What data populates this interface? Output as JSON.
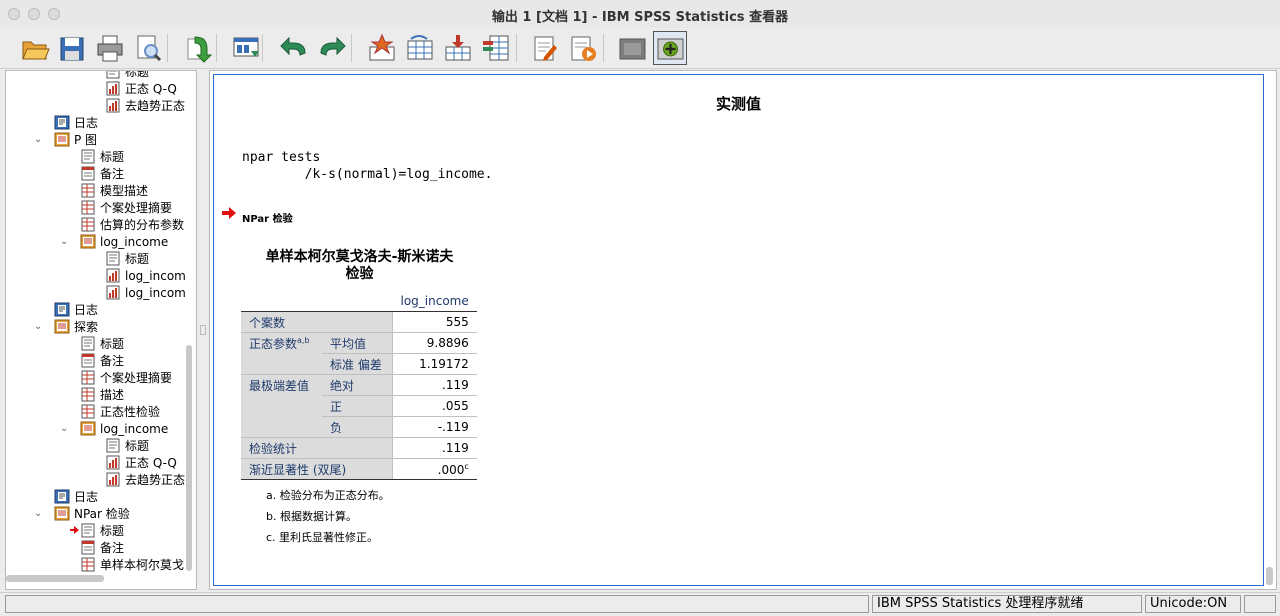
{
  "window": {
    "title": "输出 1 [文档 1] - IBM SPSS Statistics 查看器"
  },
  "toolbar": {
    "buttons": [
      {
        "name": "open-icon",
        "color": "#e8a23a"
      },
      {
        "name": "save-icon",
        "color": "#3a6fb6"
      },
      {
        "name": "print-icon",
        "color": "#666666"
      },
      {
        "name": "print-preview-icon",
        "color": "#6b8fc8"
      },
      {
        "name": "export-icon",
        "color": "#3f9e3f"
      },
      {
        "name": "recall-dialog-icon",
        "color": "#3a6fb6"
      },
      {
        "name": "undo-icon",
        "color": "#2e8b57"
      },
      {
        "name": "redo-icon",
        "color": "#2e8b57"
      },
      {
        "name": "goto-data-icon",
        "color": "#e06a1f"
      },
      {
        "name": "goto-case-icon",
        "color": "#3a6fb6"
      },
      {
        "name": "insert-cases-icon",
        "color": "#c0392b"
      },
      {
        "name": "variables-icon",
        "color": "#3a6fb6"
      },
      {
        "name": "edit-output-icon",
        "color": "#d35400"
      },
      {
        "name": "run-script-icon",
        "color": "#e67e22"
      },
      {
        "name": "designate-window-icon",
        "color": "#7d7d7d"
      },
      {
        "name": "designate-window-active-icon",
        "color": "#6aa121"
      }
    ]
  },
  "outline": {
    "items": [
      {
        "label": "标题",
        "level": 3,
        "icon": "title-icon",
        "y": 0
      },
      {
        "label": "正态 Q-Q",
        "level": 3,
        "icon": "chart-icon",
        "y": 1
      },
      {
        "label": "去趋势正态",
        "level": 3,
        "icon": "chart-icon",
        "y": 2
      },
      {
        "label": "日志",
        "level": 1,
        "icon": "log-icon",
        "y": 3
      },
      {
        "label": "P 图",
        "level": 1,
        "icon": "procedure-icon",
        "y": 4,
        "expanded": true
      },
      {
        "label": "标题",
        "level": 2,
        "icon": "title-icon",
        "y": 5
      },
      {
        "label": "备注",
        "level": 2,
        "icon": "notes-icon",
        "y": 6
      },
      {
        "label": "模型描述",
        "level": 2,
        "icon": "table-icon",
        "y": 7
      },
      {
        "label": "个案处理摘要",
        "level": 2,
        "icon": "table-icon",
        "y": 8
      },
      {
        "label": "估算的分布参数",
        "level": 2,
        "icon": "table-icon",
        "y": 9
      },
      {
        "label": "log_income",
        "level": 2,
        "icon": "procedure-icon",
        "y": 10,
        "expanded": true
      },
      {
        "label": "标题",
        "level": 3,
        "icon": "title-icon",
        "y": 11
      },
      {
        "label": "log_incom",
        "level": 3,
        "icon": "chart-icon",
        "y": 12
      },
      {
        "label": "log_incom",
        "level": 3,
        "icon": "chart-icon",
        "y": 13
      },
      {
        "label": "日志",
        "level": 1,
        "icon": "log-icon",
        "y": 14
      },
      {
        "label": "探索",
        "level": 1,
        "icon": "procedure-icon",
        "y": 15,
        "expanded": true
      },
      {
        "label": "标题",
        "level": 2,
        "icon": "title-icon",
        "y": 16
      },
      {
        "label": "备注",
        "level": 2,
        "icon": "notes-icon",
        "y": 17
      },
      {
        "label": "个案处理摘要",
        "level": 2,
        "icon": "table-icon",
        "y": 18
      },
      {
        "label": "描述",
        "level": 2,
        "icon": "table-icon",
        "y": 19
      },
      {
        "label": "正态性检验",
        "level": 2,
        "icon": "table-icon",
        "y": 20
      },
      {
        "label": "log_income",
        "level": 2,
        "icon": "procedure-icon",
        "y": 21,
        "expanded": true
      },
      {
        "label": "标题",
        "level": 3,
        "icon": "title-icon",
        "y": 22
      },
      {
        "label": "正态 Q-Q",
        "level": 3,
        "icon": "chart-icon",
        "y": 23
      },
      {
        "label": "去趋势正态",
        "level": 3,
        "icon": "chart-icon",
        "y": 24
      },
      {
        "label": "日志",
        "level": 1,
        "icon": "log-icon",
        "y": 25
      },
      {
        "label": "NPar 检验",
        "level": 1,
        "icon": "procedure-icon",
        "y": 26,
        "expanded": true
      },
      {
        "label": "标题",
        "level": 2,
        "icon": "title-icon",
        "y": 27,
        "current": true
      },
      {
        "label": "备注",
        "level": 2,
        "icon": "notes-icon",
        "y": 28
      },
      {
        "label": "单样本柯尔莫戈",
        "level": 2,
        "icon": "table-icon",
        "y": 29
      }
    ]
  },
  "output": {
    "heading": "实测值",
    "syntax": "npar tests\n        /k-s(normal)=log_income.",
    "section_label": "NPar 检验",
    "table": {
      "title_line1": "单样本柯尔莫戈洛夫-斯米诺夫",
      "title_line2": "检验",
      "column": "log_income",
      "rows": {
        "n_label": "个案数",
        "n_value": "555",
        "normal_label": "正态参数",
        "normal_sup": "a,b",
        "mean_label": "平均值",
        "mean_value": "9.8896",
        "sd_label": "标准 偏差",
        "sd_value": "1.19172",
        "extreme_label": "最极端差值",
        "abs_label": "绝对",
        "abs_value": ".119",
        "pos_label": "正",
        "pos_value": ".055",
        "neg_label": "负",
        "neg_value": "-.119",
        "stat_label": "检验统计",
        "stat_value": ".119",
        "sig_label": "渐近显著性 (双尾)",
        "sig_value": ".000",
        "sig_sup": "c"
      },
      "footnotes": [
        "a. 检验分布为正态分布。",
        "b. 根据数据计算。",
        "c. 里利氏显著性修正。"
      ]
    }
  },
  "status": {
    "message": "IBM SPSS Statistics 处理程序就绪",
    "unicode": "Unicode:ON"
  }
}
